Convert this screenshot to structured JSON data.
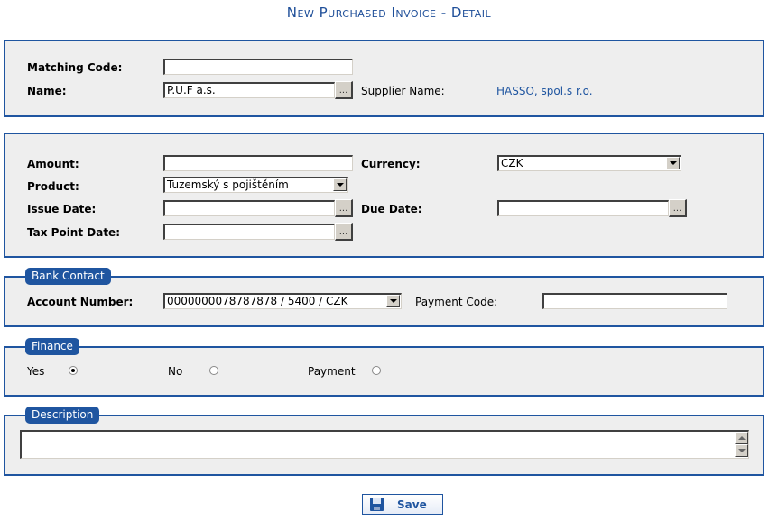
{
  "page": {
    "title": "New Purchased Invoice - Detail"
  },
  "header_section": {
    "matching_code_label": "Matching Code:",
    "matching_code_value": "",
    "name_label": "Name:",
    "name_value": "P.U.F a.s.",
    "lookup_button": "...",
    "supplier_name_label": "Supplier Name:",
    "supplier_name_value": "HASSO, spol.s r.o."
  },
  "amount_section": {
    "amount_label": "Amount:",
    "amount_value": "",
    "currency_label": "Currency:",
    "currency_value": "CZK",
    "product_label": "Product:",
    "product_value": "Tuzemský s pojištěním",
    "issue_date_label": "Issue Date:",
    "issue_date_value": "",
    "due_date_label": "Due Date:",
    "due_date_value": "",
    "tax_point_date_label": "Tax Point Date:",
    "tax_point_date_value": "",
    "picker_button": "..."
  },
  "bank_contact": {
    "legend": "Bank Contact",
    "account_number_label": "Account Number:",
    "account_number_value": "0000000078787878 / 5400 / CZK",
    "payment_code_label": "Payment Code:",
    "payment_code_value": ""
  },
  "finance": {
    "legend": "Finance",
    "options": [
      {
        "label": "Yes",
        "checked": true
      },
      {
        "label": "No",
        "checked": false
      },
      {
        "label": "Payment",
        "checked": false
      }
    ]
  },
  "description": {
    "legend": "Description",
    "value": ""
  },
  "actions": {
    "save_label": "Save"
  },
  "colors": {
    "accent": "#1f55a0",
    "panel_bg": "#eeeeee"
  }
}
